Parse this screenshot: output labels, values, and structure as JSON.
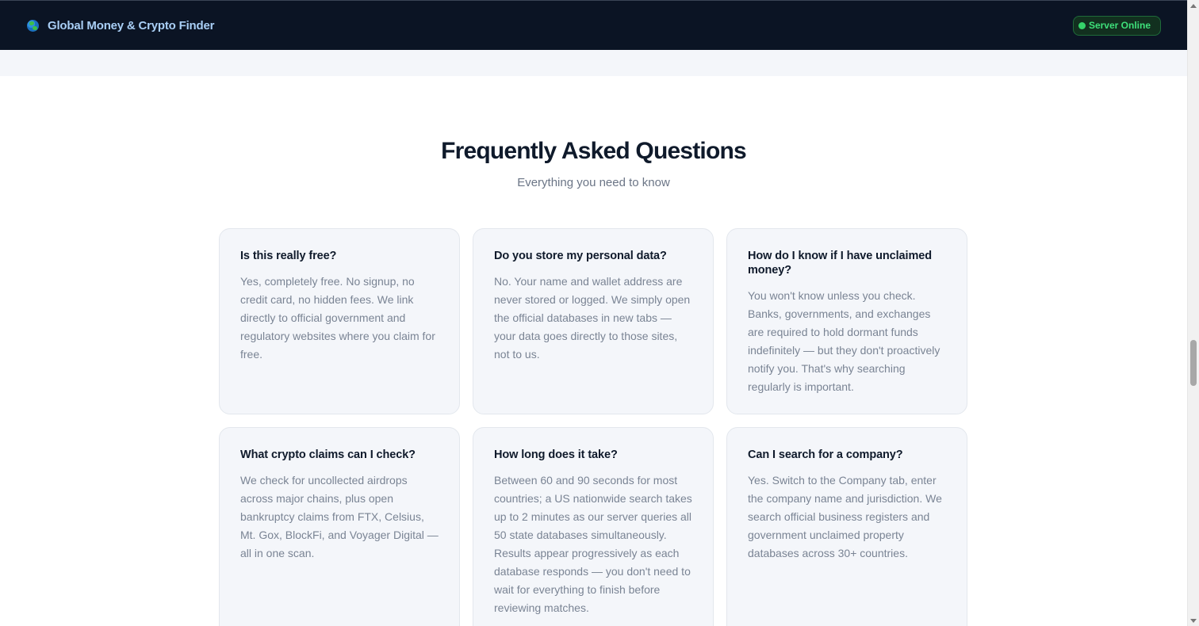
{
  "navbar": {
    "brand_icon": "globe-icon",
    "title": "Global Money & Crypto Finder",
    "status": "Server Online",
    "status_color": "#35d36a"
  },
  "faq": {
    "title": "Frequently Asked Questions",
    "subtitle": "Everything you need to know",
    "items": [
      {
        "question": "Is this really free?",
        "answer": "Yes, completely free. No signup, no credit card, no hidden fees. We link directly to official government and regulatory websites where you claim for free."
      },
      {
        "question": "Do you store my personal data?",
        "answer": "No. Your name and wallet address are never stored or logged. We simply open the official databases in new tabs — your data goes directly to those sites, not to us."
      },
      {
        "question": "How do I know if I have unclaimed money?",
        "answer": "You won't know unless you check. Banks, governments, and exchanges are required to hold dormant funds indefinitely — but they don't proactively notify you. That's why searching regularly is important."
      },
      {
        "question": "What crypto claims can I check?",
        "answer": "We check for uncollected airdrops across major chains, plus open bankruptcy claims from FTX, Celsius, Mt. Gox, BlockFi, and Voyager Digital — all in one scan."
      },
      {
        "question": "How long does it take?",
        "answer": "Between 60 and 90 seconds for most countries; a US nationwide search takes up to 2 minutes as our server queries all 50 state databases simultaneously. Results appear progressively as each database responds — you don't need to wait for everything to finish before reviewing matches."
      },
      {
        "question": "Can I search for a company?",
        "answer": "Yes. Switch to the Company tab, enter the company name and jurisdiction. We search official business registers and government unclaimed property databases across 30+ countries."
      }
    ]
  }
}
